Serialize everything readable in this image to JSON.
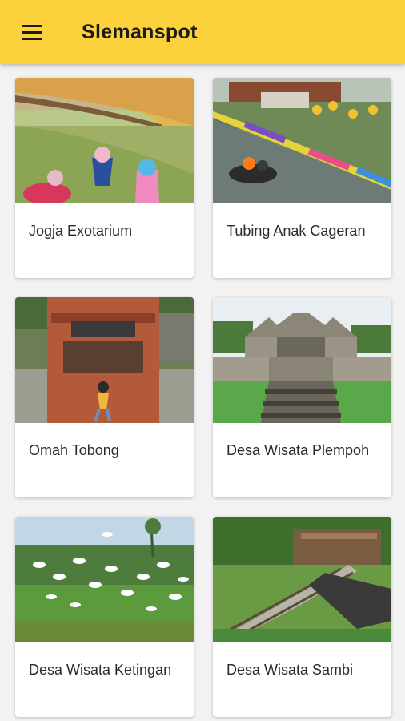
{
  "app": {
    "title": "Slemanspot",
    "menu_icon": "menu-icon"
  },
  "colors": {
    "appbar": "#fbd23c",
    "background": "#f2f2f2"
  },
  "places": [
    {
      "name": "Jogja Exotarium"
    },
    {
      "name": "Tubing Anak Cageran"
    },
    {
      "name": "Omah Tobong"
    },
    {
      "name": "Desa Wisata Plempoh"
    },
    {
      "name": "Desa Wisata Ketingan"
    },
    {
      "name": "Desa Wisata Sambi"
    }
  ]
}
